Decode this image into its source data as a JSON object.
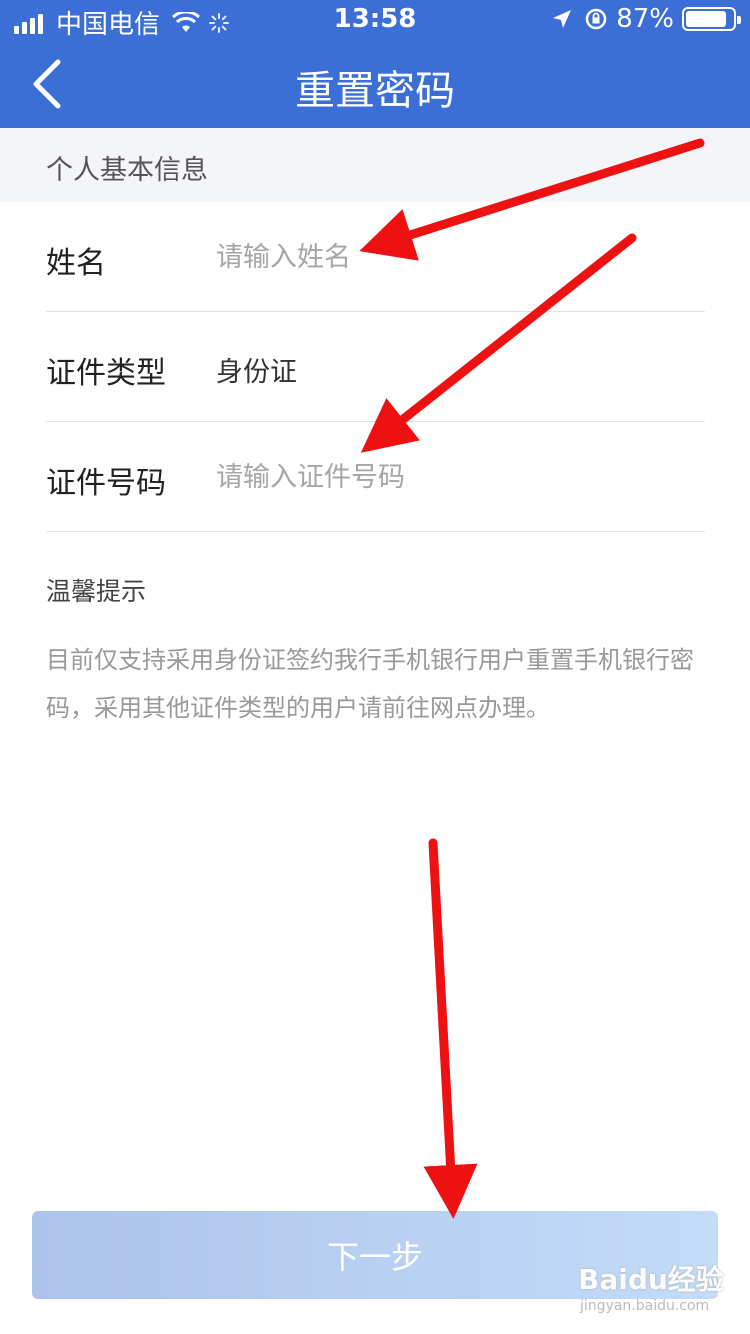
{
  "status_bar": {
    "carrier": "中国电信",
    "time": "13:58",
    "battery": "87%",
    "battery_level": 0.87
  },
  "nav": {
    "title": "重置密码",
    "back_icon": "chevron-left-icon"
  },
  "section": {
    "title": "个人基本信息"
  },
  "form": {
    "name_label": "姓名",
    "name_placeholder": "请输入姓名",
    "id_type_label": "证件类型",
    "id_type_value": "身份证",
    "id_number_label": "证件号码",
    "id_number_placeholder": "请输入证件号码"
  },
  "tips": {
    "title": "温馨提示",
    "body": "目前仅支持采用身份证签约我行手机银行用户重置手机银行密码，采用其他证件类型的用户请前往网点办理。"
  },
  "actions": {
    "next_label": "下一步"
  },
  "watermark": {
    "brand": "Baidu经验",
    "sub": "jingyan.baidu.com"
  },
  "colors": {
    "header": "#3b6fd6",
    "annotation": "#ee1111",
    "button_start": "#adc3ea",
    "button_end": "#c3dcf8"
  }
}
